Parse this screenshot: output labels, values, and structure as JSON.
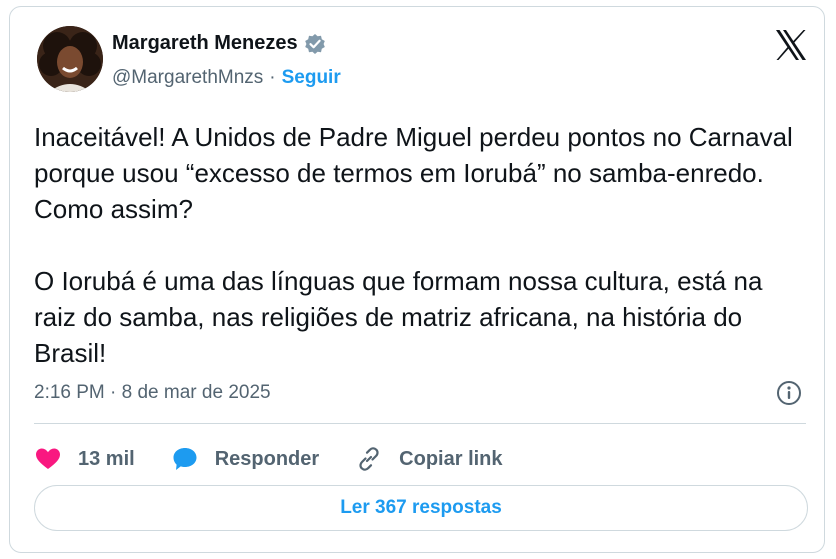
{
  "author": {
    "display_name": "Margareth Menezes",
    "handle": "@MargarethMnzs",
    "separator": "·",
    "follow_label": "Seguir"
  },
  "tweet": {
    "text": "Inaceitável! A Unidos de Padre Miguel perdeu pontos no Carnaval porque usou “excesso de termos em Iorubá” no samba-enredo. Como assim?\n\nO Iorubá é uma das línguas que formam nossa cultura, está na raiz do samba, nas religiões de matriz africana, na história do Brasil!",
    "timestamp": "2:16 PM · 8 de mar de 2025"
  },
  "actions": {
    "like_count": "13 mil",
    "reply_label": "Responder",
    "copy_link_label": "Copiar link"
  },
  "read_replies_label": "Ler 367 respostas",
  "icons": {
    "verified": "verified-badge-icon",
    "x_logo": "x-logo-icon",
    "info": "info-icon",
    "like": "heart-icon",
    "reply": "speech-bubble-icon",
    "copy_link": "link-icon"
  },
  "colors": {
    "accent": "#1d9bf0",
    "like": "#f91880",
    "text": "#0f1419",
    "muted": "#536471",
    "border": "#cfd9de"
  }
}
